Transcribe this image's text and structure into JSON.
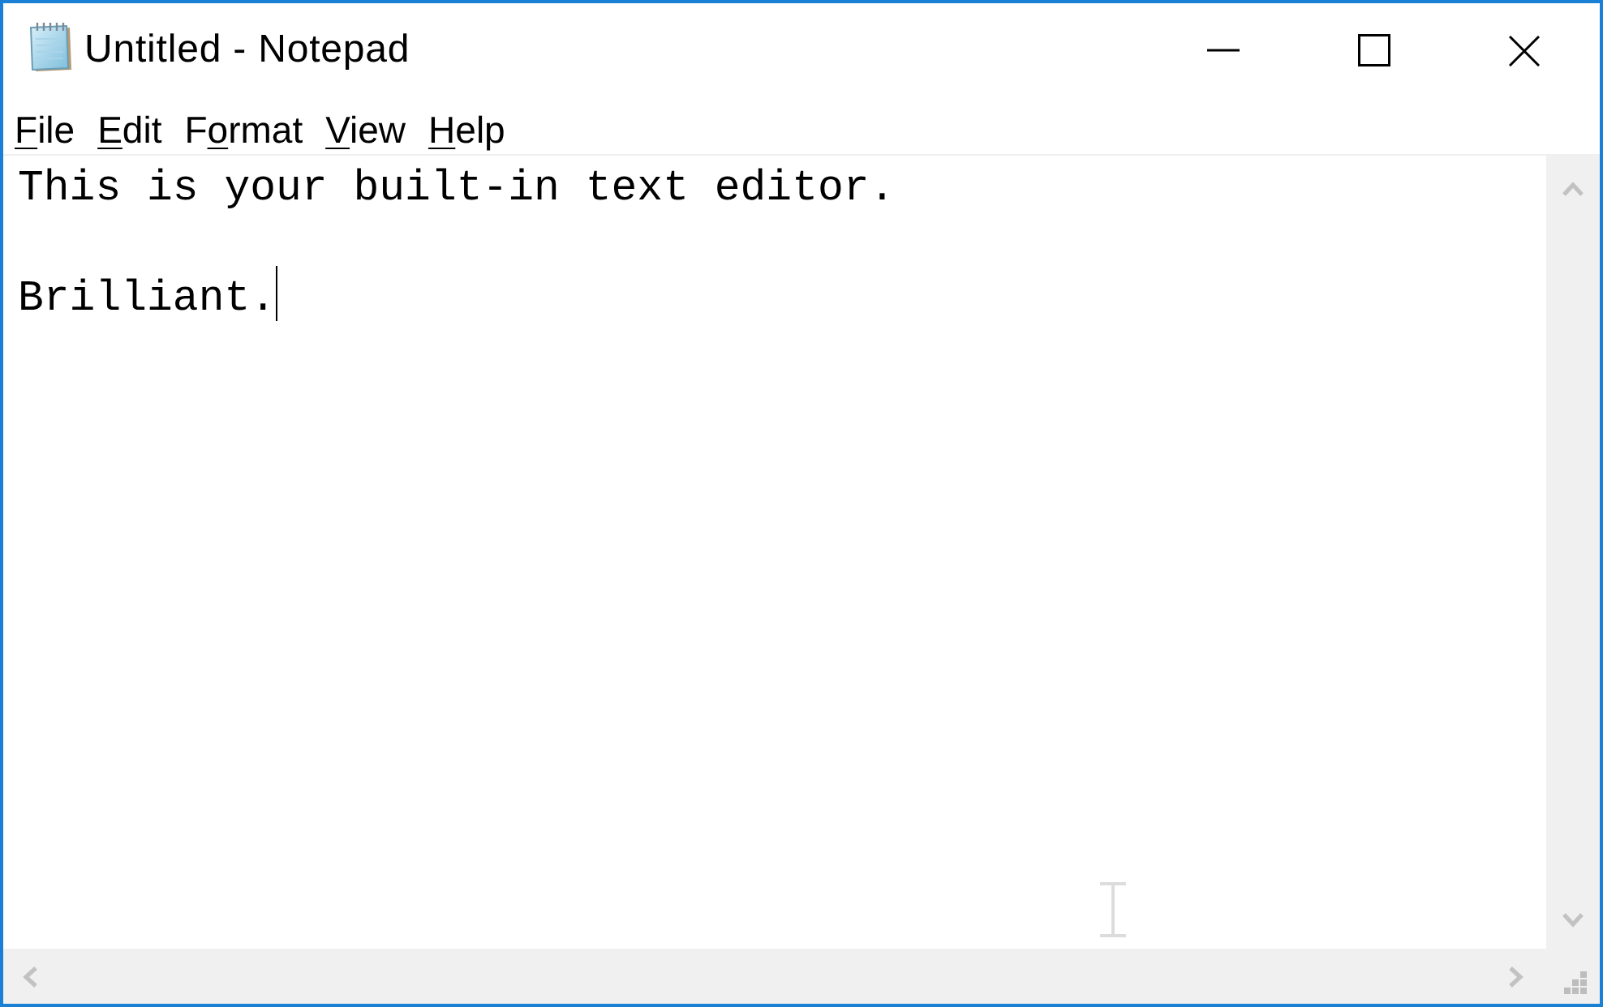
{
  "window": {
    "title": "Untitled - Notepad",
    "controls": [
      {
        "kind": "minimize"
      },
      {
        "kind": "maximize"
      },
      {
        "kind": "close"
      }
    ]
  },
  "menu_bar": {
    "items": [
      {
        "access_key": "F",
        "after": "ile"
      },
      {
        "access_key": "E",
        "after": "dit"
      },
      {
        "before": "F",
        "access_key": "o",
        "after": "rmat"
      },
      {
        "access_key": "V",
        "after": "iew"
      },
      {
        "access_key": "H",
        "after": "elp"
      }
    ]
  },
  "editor": {
    "text": "This is your built-in text editor.\n\nBrilliant."
  }
}
